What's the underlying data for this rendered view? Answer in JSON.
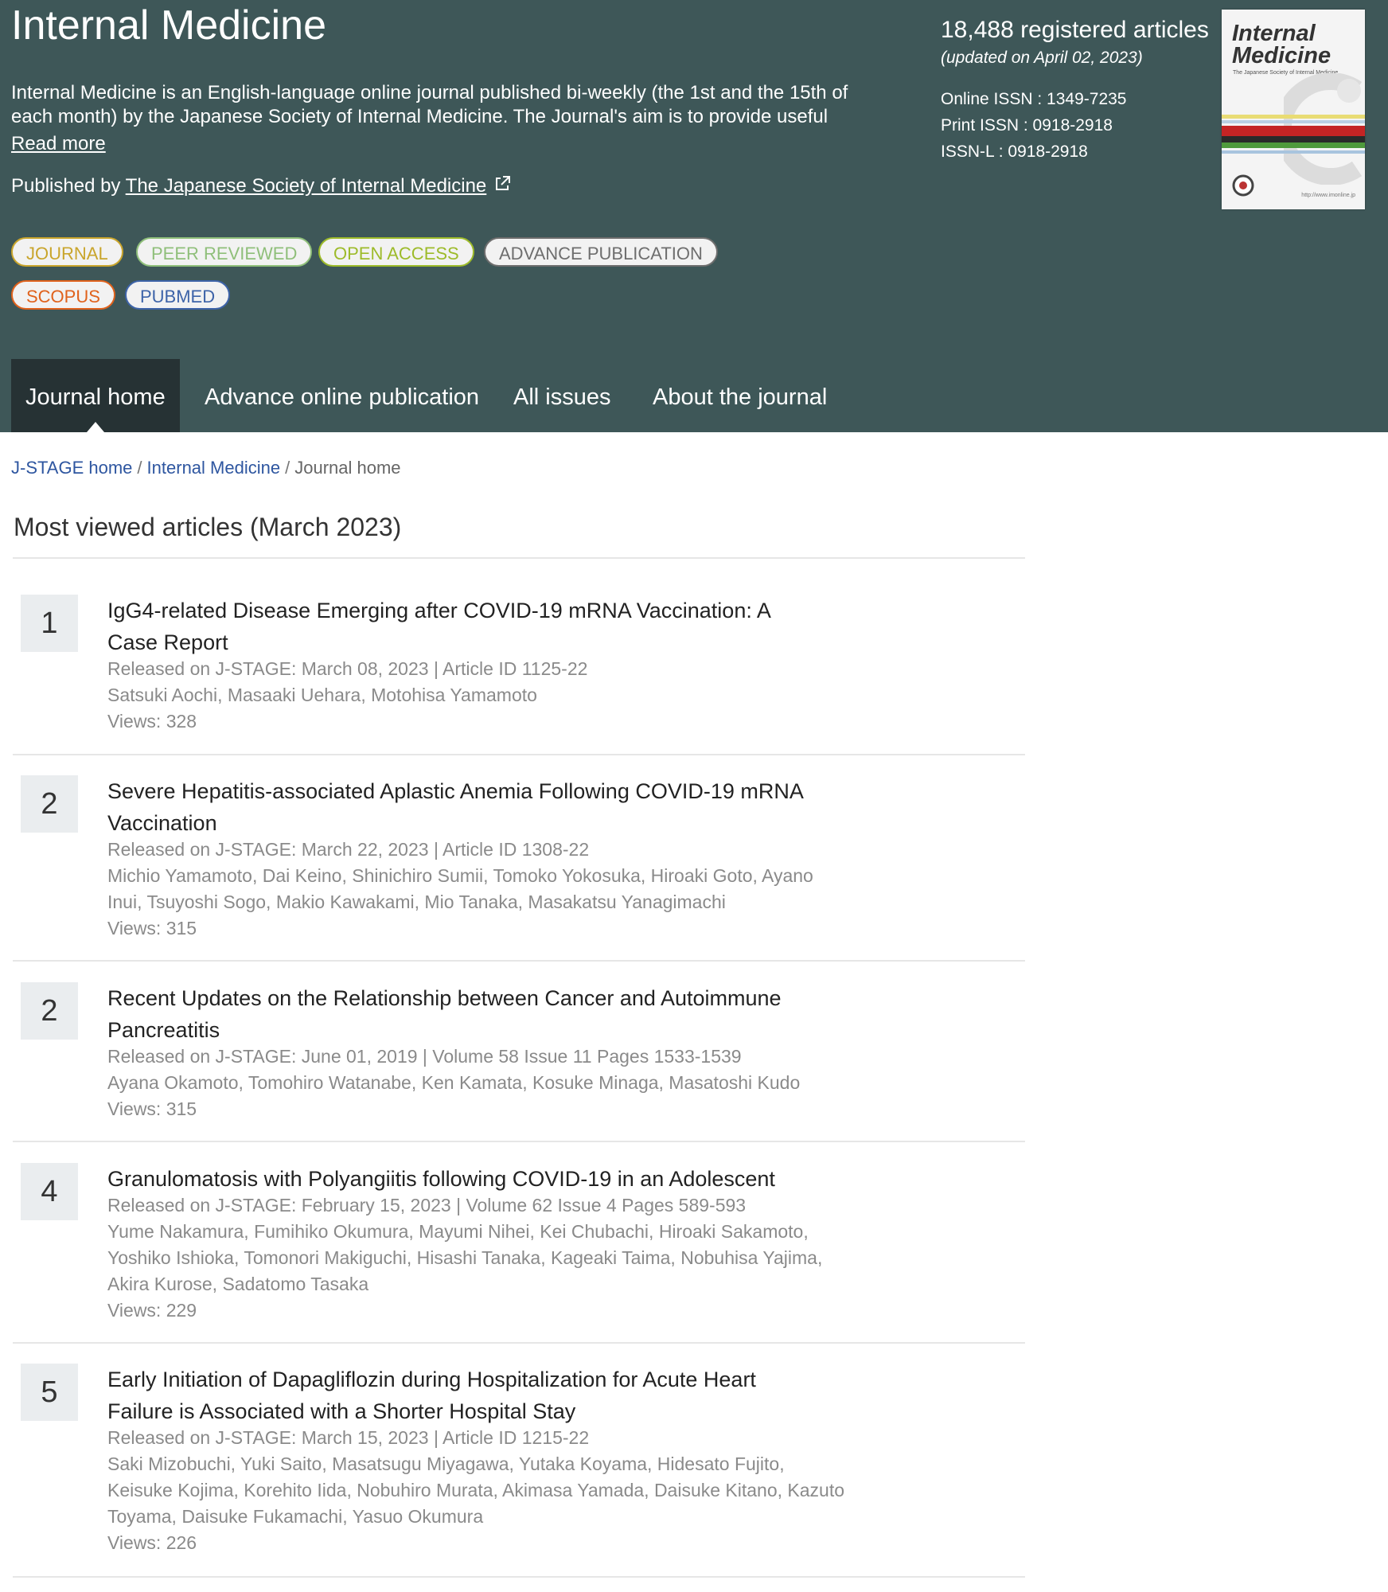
{
  "journal": {
    "title": "Internal Medicine",
    "description": "Internal Medicine is an English-language online journal published bi-weekly (the 1st and the 15th of each month) by the Japanese Society of Internal Medicine.  The Journal's aim is to provide useful",
    "read_more": "Read more",
    "published_by_label": "Published by ",
    "publisher": "The Japanese Society of Internal Medicine"
  },
  "badges": [
    {
      "label": "JOURNAL",
      "color": "#c9a52c"
    },
    {
      "label": "PEER REVIEWED",
      "color": "#8fbf7a"
    },
    {
      "label": "OPEN ACCESS",
      "color": "#9dbb2a"
    },
    {
      "label": "ADVANCE PUBLICATION",
      "color": "#6e6e6e"
    },
    {
      "label": "SCOPUS",
      "color": "#e0621c"
    },
    {
      "label": "PUBMED",
      "color": "#3d63a8"
    }
  ],
  "stats": {
    "registered": "18,488 registered articles",
    "updated": "(updated on April 02, 2023)",
    "online_issn": "Online ISSN : 1349-7235",
    "print_issn": "Print ISSN : 0918-2918",
    "issn_l": "ISSN-L : 0918-2918"
  },
  "cover": {
    "title_line1": "Internal",
    "title_line2": "Medicine",
    "subtitle": "The Japanese Society of Internal Medicine",
    "url": "http://www.imonline.jp"
  },
  "nav": {
    "tabs": [
      "Journal home",
      "Advance online publication",
      "All issues",
      "About the journal"
    ]
  },
  "breadcrumb": {
    "home": "J-STAGE home",
    "journal": "Internal Medicine",
    "current": "Journal home",
    "separator": "/"
  },
  "section_title": "Most viewed articles (March 2023)",
  "articles": [
    {
      "rank": "1",
      "title": "IgG4-related Disease Emerging after COVID-19 mRNA Vaccination: A Case Report",
      "release": "Released on J-STAGE: March 08, 2023 | Article ID 1125-22",
      "authors": "Satsuki Aochi, Masaaki Uehara, Motohisa Yamamoto",
      "views": "Views: 328"
    },
    {
      "rank": "2",
      "title": "Severe Hepatitis-associated Aplastic Anemia Following COVID-19 mRNA Vaccination",
      "release": "Released on J-STAGE: March 22, 2023 | Article ID 1308-22",
      "authors": "Michio Yamamoto, Dai Keino, Shinichiro Sumii, Tomoko Yokosuka, Hiroaki Goto, Ayano Inui, Tsuyoshi Sogo, Makio Kawakami, Mio Tanaka, Masakatsu Yanagimachi",
      "views": "Views: 315"
    },
    {
      "rank": "2",
      "title": "Recent Updates on the Relationship between Cancer and Autoimmune Pancreatitis",
      "release": "Released on J-STAGE: June 01, 2019 | Volume 58 Issue 11 Pages 1533-1539",
      "authors": "Ayana Okamoto, Tomohiro Watanabe, Ken Kamata, Kosuke Minaga, Masatoshi Kudo",
      "views": "Views: 315"
    },
    {
      "rank": "4",
      "title": "Granulomatosis with Polyangiitis following COVID-19 in an Adolescent",
      "release": "Released on J-STAGE: February 15, 2023 | Volume 62 Issue 4 Pages 589-593",
      "authors": "Yume Nakamura, Fumihiko Okumura, Mayumi Nihei, Kei Chubachi, Hiroaki Sakamoto, Yoshiko Ishioka, Tomonori Makiguchi, Hisashi Tanaka, Kageaki Taima, Nobuhisa Yajima, Akira Kurose, Sadatomo Tasaka",
      "views": "Views: 229"
    },
    {
      "rank": "5",
      "title": "Early Initiation of Dapagliflozin during Hospitalization for Acute Heart Failure is Associated with a Shorter Hospital Stay",
      "release": "Released on J-STAGE: March 15, 2023 | Article ID 1215-22",
      "authors": "Saki Mizobuchi, Yuki Saito, Masatsugu Miyagawa, Yutaka Koyama, Hidesato Fujito, Keisuke Kojima, Korehito Iida, Nobuhiro Murata, Akimasa Yamada, Daisuke Kitano, Kazuto Toyama, Daisuke Fukamachi, Yasuo Okumura",
      "views": "Views: 226"
    }
  ]
}
